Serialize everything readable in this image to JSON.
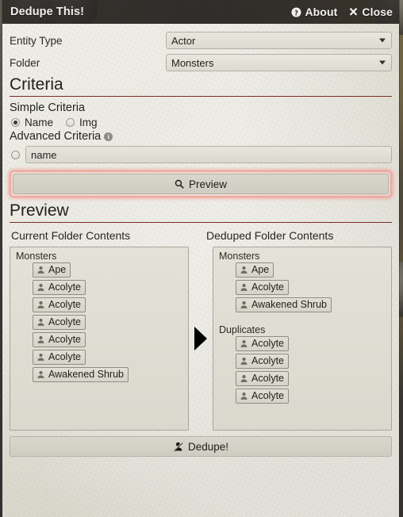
{
  "window": {
    "title": "Dedupe This!",
    "about_label": "About",
    "close_label": "Close",
    "about_icon": "question-circle-icon",
    "close_icon": "close-x-icon"
  },
  "form": {
    "entity_type": {
      "label": "Entity Type",
      "value": "Actor"
    },
    "folder": {
      "label": "Folder",
      "value": "Monsters"
    }
  },
  "criteria": {
    "heading": "Criteria",
    "simple_label": "Simple Criteria",
    "options": [
      {
        "label": "Name",
        "selected": true
      },
      {
        "label": "Img",
        "selected": false
      }
    ],
    "advanced_label": "Advanced Criteria",
    "advanced_info_icon": "info-icon",
    "advanced_radio_selected": false,
    "advanced_value": "name",
    "advanced_placeholder": "name"
  },
  "actions": {
    "preview_label": "Preview",
    "preview_icon": "search-icon",
    "dedupe_label": "Dedupe!",
    "dedupe_icon": "user-slash-icon"
  },
  "preview": {
    "heading": "Preview",
    "left_header": "Current Folder Contents",
    "right_header": "Deduped Folder Contents",
    "arrow_icon": "arrow-right-icon",
    "left": {
      "groups": [
        {
          "name": "Monsters",
          "items": [
            {
              "label": "Ape",
              "icon": "user-icon"
            },
            {
              "label": "Acolyte",
              "icon": "user-icon"
            },
            {
              "label": "Acolyte",
              "icon": "user-icon"
            },
            {
              "label": "Acolyte",
              "icon": "user-icon"
            },
            {
              "label": "Acolyte",
              "icon": "user-icon"
            },
            {
              "label": "Acolyte",
              "icon": "user-icon"
            },
            {
              "label": "Awakened Shrub",
              "icon": "user-icon"
            }
          ]
        }
      ]
    },
    "right": {
      "groups": [
        {
          "name": "Monsters",
          "items": [
            {
              "label": "Ape",
              "icon": "user-icon"
            },
            {
              "label": "Acolyte",
              "icon": "user-icon"
            },
            {
              "label": "Awakened Shrub",
              "icon": "user-icon"
            }
          ]
        },
        {
          "name": "Duplicates",
          "items": [
            {
              "label": "Acolyte",
              "icon": "user-icon"
            },
            {
              "label": "Acolyte",
              "icon": "user-icon"
            },
            {
              "label": "Acolyte",
              "icon": "user-icon"
            },
            {
              "label": "Acolyte",
              "icon": "user-icon"
            }
          ]
        }
      ]
    }
  },
  "colors": {
    "accent_rule": "#7d2c24",
    "focus_ring": "#f2a79e",
    "parchment": "#e2e0d6",
    "titlebar": "#282623"
  }
}
